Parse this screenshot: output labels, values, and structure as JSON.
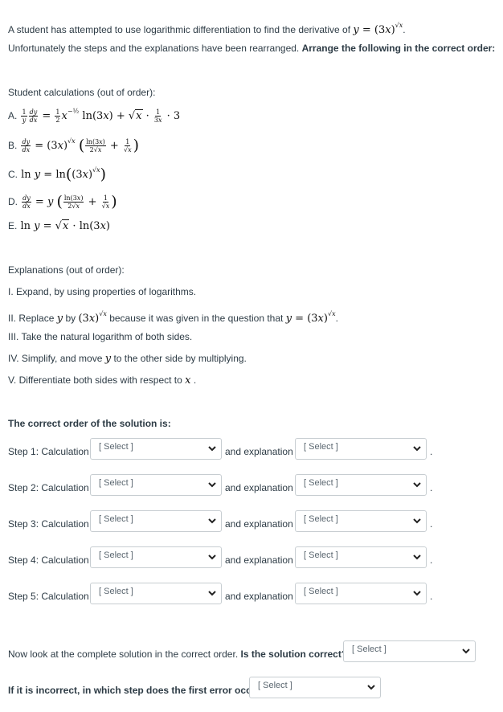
{
  "intro": {
    "line1": "A student has attempted to use logarithmic differentiation to find the derivative of",
    "equation": "y = (3x)^√x",
    "line2_plain": "Unfortunately the steps and the explanations have been rearranged.",
    "line2_bold": "Arrange the following in the correct order:"
  },
  "calculations": {
    "heading": "Student calculations (out of order):",
    "items": [
      {
        "label": "A.",
        "expression": "(1/y)(dy/dx) = (1/2)x^(-1/2) ln(3x) + √x · (1/(3x)) · 3"
      },
      {
        "label": "B.",
        "expression": "dy/dx = (3x)^√x (ln(3x)/(2√x) + 1/√x)"
      },
      {
        "label": "C.",
        "expression": "ln y = ln((3x)^√x)"
      },
      {
        "label": "D.",
        "expression": "dy/dx = y (ln(3x)/(2√x) + 1/√x)"
      },
      {
        "label": "E.",
        "expression": "ln y = √x · ln(3x)"
      }
    ]
  },
  "explanations": {
    "heading": "Explanations (out of order):",
    "items": [
      {
        "label": "I.",
        "text": "Expand, by using properties of logarithms."
      },
      {
        "label": "II.",
        "text_a": "Replace",
        "var": "y",
        "text_b": "by",
        "expr": "(3x)^√x",
        "text_c": "because it was given in the question that",
        "expr2": "y = (3x)^√x"
      },
      {
        "label": "III.",
        "text": "Take the natural logarithm of both sides."
      },
      {
        "label": "IV.",
        "text_a": "Simplify, and move",
        "var": "y",
        "text_b": "to the other side by multiplying."
      },
      {
        "label": "V.",
        "text_a": "Differentiate both sides with respect to",
        "var": "x"
      }
    ]
  },
  "order": {
    "heading": "The correct order of the solution is:",
    "steps": [
      {
        "label": "Step 1: Calculation",
        "calc_value": "[ Select ]",
        "and_label": "and explanation",
        "expl_value": "[ Select ]"
      },
      {
        "label": "Step 2: Calculation",
        "calc_value": "[ Select ]",
        "and_label": "and explanation",
        "expl_value": "[ Select ]"
      },
      {
        "label": "Step 3: Calculation",
        "calc_value": "[ Select ]",
        "and_label": "and explanation",
        "expl_value": "[ Select ]"
      },
      {
        "label": "Step 4: Calculation",
        "calc_value": "[ Select ]",
        "and_label": "and explanation",
        "expl_value": "[ Select ]"
      },
      {
        "label": "Step 5: Calculation",
        "calc_value": "[ Select ]",
        "and_label": "and explanation",
        "expl_value": "[ Select ]"
      }
    ]
  },
  "final": {
    "q1_plain": "Now look at the complete solution in the correct order.",
    "q1_bold": "Is the solution correct?",
    "q1_value": "[ Select ]",
    "q2_bold": "If it is incorrect, in which step does the first error occur?",
    "q2_value": "[ Select ]"
  },
  "colors": {
    "text": "#2d3b45",
    "select_border": "#c7cdd1",
    "select_text": "#5b6770"
  }
}
